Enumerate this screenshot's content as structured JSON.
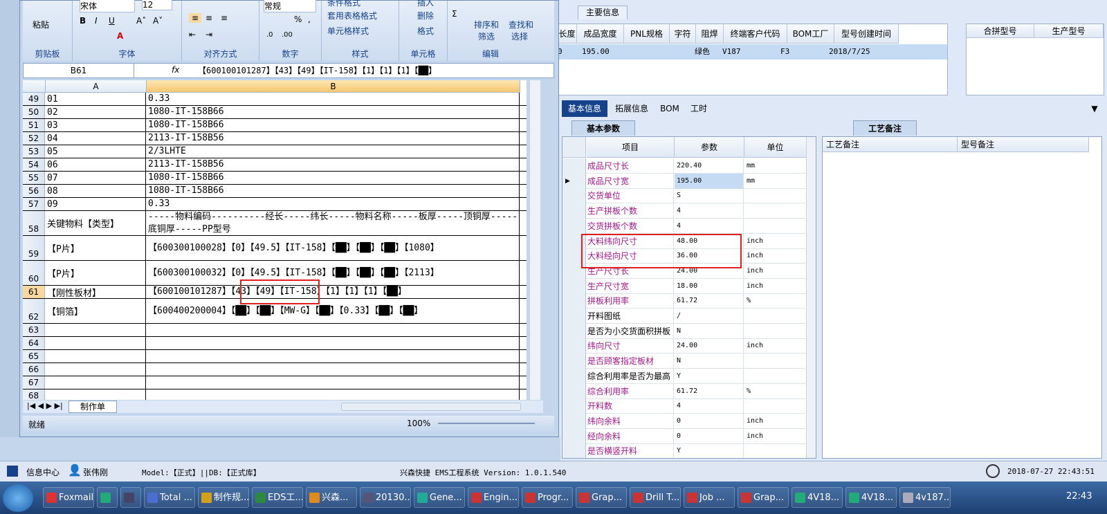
{
  "excel": {
    "ribbon": {
      "clipboard": {
        "paste": "粘贴",
        "group": "剪贴板"
      },
      "font": {
        "name": "宋体",
        "size": "12",
        "group": "字体"
      },
      "alignment": {
        "group": "对齐方式"
      },
      "number": {
        "format": "常规",
        "group": "数字"
      },
      "styles": {
        "cond": "条件格式",
        "table": "套用表格格式",
        "cell": "单元格样式",
        "group": "样式"
      },
      "cells": {
        "insert": "插入",
        "delete": "删除",
        "format": "格式",
        "group": "单元格"
      },
      "editing": {
        "sort": "排序和",
        "sort2": "筛选",
        "find": "查找和",
        "find2": "选择",
        "group": "编辑"
      }
    },
    "formula_bar": {
      "name_box": "B61",
      "fx": "fx",
      "value": "【600100101287】【43】【49】【IT-158】【1】【1】【1】【██】"
    },
    "columns": [
      "A",
      "B"
    ],
    "rows": [
      {
        "n": "49",
        "a": "01",
        "b": "0.33"
      },
      {
        "n": "50",
        "a": "02",
        "b": "1080-IT-158B66"
      },
      {
        "n": "51",
        "a": "03",
        "b": "1080-IT-158B66"
      },
      {
        "n": "52",
        "a": "04",
        "b": "2113-IT-158B56"
      },
      {
        "n": "53",
        "a": "05",
        "b": "2/3LHTE"
      },
      {
        "n": "54",
        "a": "06",
        "b": "2113-IT-158B56"
      },
      {
        "n": "55",
        "a": "07",
        "b": "1080-IT-158B66"
      },
      {
        "n": "56",
        "a": "08",
        "b": "1080-IT-158B66"
      },
      {
        "n": "57",
        "a": "09",
        "b": "0.33"
      },
      {
        "n": "58",
        "a": "关键物料【类型】",
        "b": "-----物料编码----------经长-----纬长-----物料名称-----板厚-----顶铜厚-----底铜厚-----PP型号"
      },
      {
        "n": "59",
        "a": "【P片】",
        "b": "【600300100028】【0】【49.5】【IT-158】【██】【██】【██】【1080】"
      },
      {
        "n": "60",
        "a": "【P片】",
        "b": "【600300100032】【0】【49.5】【IT-158】【██】【██】【██】【2113】"
      },
      {
        "n": "61",
        "a": "【刚性板材】",
        "b": "【600100101287】【43】【49】【IT-158】【1】【1】【1】【██】"
      },
      {
        "n": "62",
        "a": "【铜箔】",
        "b": "【600400200004】【██】【██】【MW-G】【██】【0.33】【██】【██】"
      },
      {
        "n": "63",
        "a": "",
        "b": ""
      },
      {
        "n": "64",
        "a": "",
        "b": ""
      },
      {
        "n": "65",
        "a": "",
        "b": ""
      },
      {
        "n": "66",
        "a": "",
        "b": ""
      },
      {
        "n": "67",
        "a": "",
        "b": ""
      },
      {
        "n": "68",
        "a": "",
        "b": ""
      }
    ],
    "sheet_tab": "制作单",
    "status": {
      "ready": "就绪",
      "zoom": "100%"
    }
  },
  "erp": {
    "main_info_tab": "主要信息",
    "top_grid": {
      "headers": [
        "长度",
        "成品宽度",
        "PNL规格",
        "字符",
        "阻焊",
        "终端客户代码",
        "BOM工厂",
        "型号创建时间"
      ],
      "row": [
        "0",
        "195.00",
        "",
        "",
        "绿色",
        "V187",
        "F3",
        "2018/7/25"
      ]
    },
    "right_grid_headers": [
      "合拼型号",
      "生产型号"
    ],
    "tabs": [
      "基本信息",
      "拓展信息",
      "BOM",
      "工时"
    ],
    "basic_params_tab": "基本参数",
    "param_headers": [
      "项目",
      "参数",
      "单位"
    ],
    "params": [
      {
        "name": "成品尺寸长",
        "value": "220.40",
        "unit": "mm",
        "purple": true
      },
      {
        "name": "成品尺寸宽",
        "value": "195.00",
        "unit": "mm",
        "purple": true
      },
      {
        "name": "交货单位",
        "value": "S",
        "unit": "",
        "purple": true
      },
      {
        "name": "生产拼板个数",
        "value": "4",
        "unit": "",
        "purple": true
      },
      {
        "name": "交货拼板个数",
        "value": "4",
        "unit": "",
        "purple": true
      },
      {
        "name": "大料纬向尺寸",
        "value": "48.00",
        "unit": "inch",
        "purple": true
      },
      {
        "name": "大料经向尺寸",
        "value": "36.00",
        "unit": "inch",
        "purple": true
      },
      {
        "name": "生产尺寸长",
        "value": "24.00",
        "unit": "inch",
        "purple": true
      },
      {
        "name": "生产尺寸宽",
        "value": "18.00",
        "unit": "inch",
        "purple": true
      },
      {
        "name": "拼板利用率",
        "value": "61.72",
        "unit": "%",
        "purple": true
      },
      {
        "name": "开料图纸",
        "value": "/",
        "unit": "",
        "purple": false
      },
      {
        "name": "是否为小交货面积拼板",
        "value": "N",
        "unit": "",
        "purple": false
      },
      {
        "name": "纬向尺寸",
        "value": "24.00",
        "unit": "inch",
        "purple": true
      },
      {
        "name": "是否顾客指定板材",
        "value": "N",
        "unit": "",
        "purple": true
      },
      {
        "name": "综合利用率是否为最高",
        "value": "Y",
        "unit": "",
        "purple": false
      },
      {
        "name": "综合利用率",
        "value": "61.72",
        "unit": "%",
        "purple": true
      },
      {
        "name": "开料数",
        "value": "4",
        "unit": "",
        "purple": true
      },
      {
        "name": "纬向余料",
        "value": "0",
        "unit": "inch",
        "purple": true
      },
      {
        "name": "经向余料",
        "value": "0",
        "unit": "inch",
        "purple": true
      },
      {
        "name": "是否横竖开料",
        "value": "Y",
        "unit": "",
        "purple": true
      }
    ],
    "craft_tab": "工艺备注",
    "craft_headers": [
      "工艺备注",
      "型号备注"
    ]
  },
  "infobar": {
    "info_center": "信息中心",
    "user": "张伟刚",
    "model": "Model:【正式】||DB:【正式库】",
    "system": "兴森快捷 EMS工程系统 Version: 1.0.1.540",
    "datetime": "2018-07-27 22:43:51"
  },
  "taskbar": {
    "items": [
      "Foxmail",
      "",
      "",
      "Total ...",
      "制作规...",
      "EDS工...",
      "兴森...",
      "20130...",
      "Gene...",
      "Engin...",
      "Progr...",
      "Grap...",
      "Drill T...",
      "Job ...",
      "Grap...",
      "4V18...",
      "4V18...",
      "4v187..."
    ],
    "clock": "22:43"
  },
  "colors": {
    "accent": "#15428b",
    "purple_label": "#a0188c",
    "highlight_box": "#e02020"
  }
}
